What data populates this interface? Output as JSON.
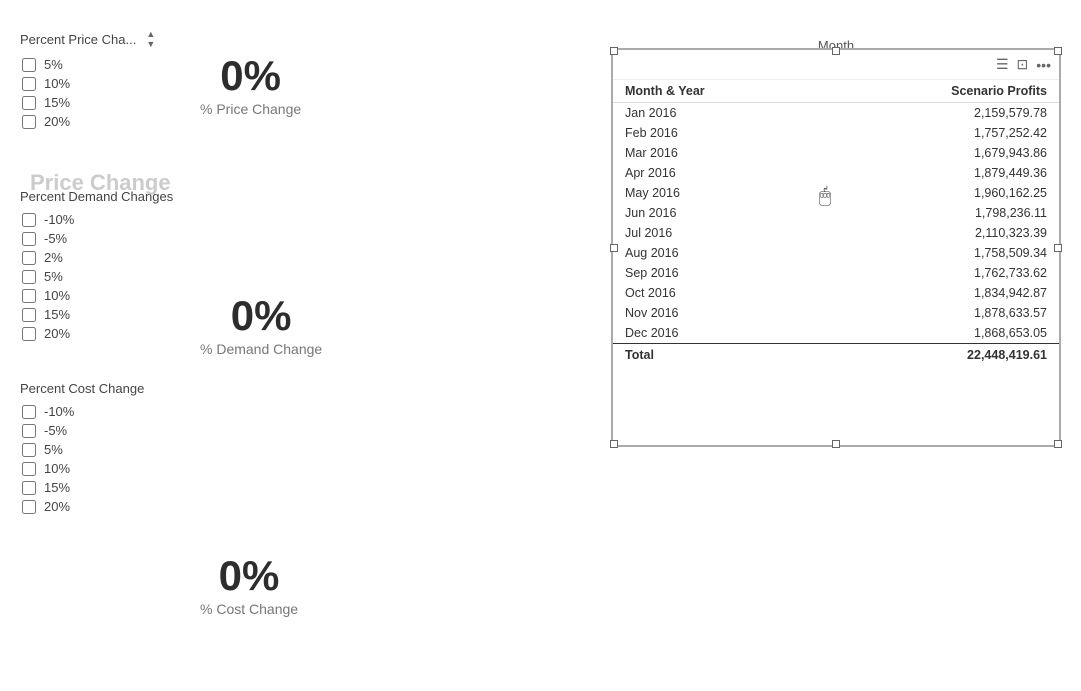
{
  "left": {
    "price_section": {
      "label": "Percent Price Cha...",
      "options": [
        "5%",
        "10%",
        "15%",
        "20%"
      ]
    },
    "demand_section": {
      "label": "Percent Demand Changes",
      "options": [
        "-10%",
        "-5%",
        "2%",
        "5%",
        "10%",
        "15%",
        "20%"
      ]
    },
    "cost_section": {
      "label": "Percent Cost Change",
      "options": [
        "-10%",
        "-5%",
        "5%",
        "10%",
        "15%",
        "20%"
      ]
    }
  },
  "values": {
    "price_value": "0%",
    "price_label": "% Price Change",
    "demand_value": "0%",
    "demand_label": "% Demand Change",
    "cost_value": "0%",
    "cost_label": "% Cost Change"
  },
  "price_change_watermark": "Price Change",
  "table": {
    "month_label": "Month",
    "title": "",
    "toolbar_icons": [
      "menu",
      "expand",
      "more"
    ],
    "columns": [
      "Month & Year",
      "Scenario Profits"
    ],
    "rows": [
      {
        "month": "Jan 2016",
        "profits": "2,159,579.78"
      },
      {
        "month": "Feb 2016",
        "profits": "1,757,252.42"
      },
      {
        "month": "Mar 2016",
        "profits": "1,679,943.86"
      },
      {
        "month": "Apr 2016",
        "profits": "1,879,449.36"
      },
      {
        "month": "May 2016",
        "profits": "1,960,162.25"
      },
      {
        "month": "Jun 2016",
        "profits": "1,798,236.11"
      },
      {
        "month": "Jul 2016",
        "profits": "2,110,323.39"
      },
      {
        "month": "Aug 2016",
        "profits": "1,758,509.34"
      },
      {
        "month": "Sep 2016",
        "profits": "1,762,733.62"
      },
      {
        "month": "Oct 2016",
        "profits": "1,834,942.87"
      },
      {
        "month": "Nov 2016",
        "profits": "1,878,633.57"
      },
      {
        "month": "Dec 2016",
        "profits": "1,868,653.05"
      }
    ],
    "total_label": "Total",
    "total_value": "22,448,419.61"
  }
}
